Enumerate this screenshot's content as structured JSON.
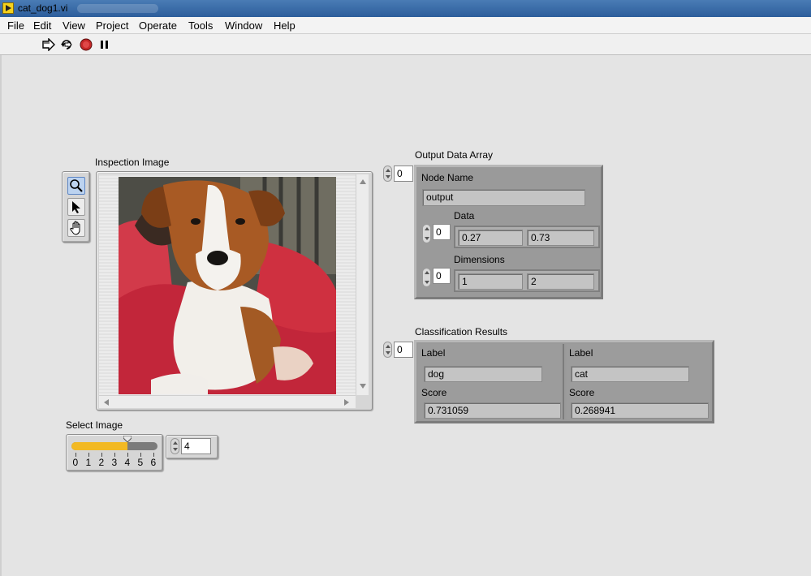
{
  "window": {
    "title": "cat_dog1.vi"
  },
  "menu": [
    "File",
    "Edit",
    "View",
    "Project",
    "Operate",
    "Tools",
    "Window",
    "Help"
  ],
  "toolbar": {
    "icons": [
      "run-arrow-icon",
      "run-continuously-icon",
      "abort-execution-icon",
      "pause-icon"
    ]
  },
  "inspection": {
    "label": "Inspection Image",
    "tools": [
      "zoom-icon",
      "select-arrow-icon",
      "pan-hand-icon"
    ]
  },
  "select_image": {
    "label": "Select Image",
    "ticks": [
      "0",
      "1",
      "2",
      "3",
      "4",
      "5",
      "6"
    ],
    "value": 4,
    "min": 0,
    "max": 6,
    "numeric_value": "4"
  },
  "output_array": {
    "label": "Output Data Array",
    "index": "0",
    "node_name_label": "Node Name",
    "node_name": "output",
    "data_label": "Data",
    "data_index": "0",
    "data": [
      "0.27",
      "0.73"
    ],
    "dimensions_label": "Dimensions",
    "dimensions_index": "0",
    "dimensions": [
      "1",
      "2"
    ]
  },
  "classification": {
    "label": "Classification Results",
    "index": "0",
    "results": [
      {
        "label_caption": "Label",
        "label": "dog",
        "score_caption": "Score",
        "score": "0.731059"
      },
      {
        "label_caption": "Label",
        "label": "cat",
        "score_caption": "Score",
        "score": "0.268941"
      }
    ]
  }
}
